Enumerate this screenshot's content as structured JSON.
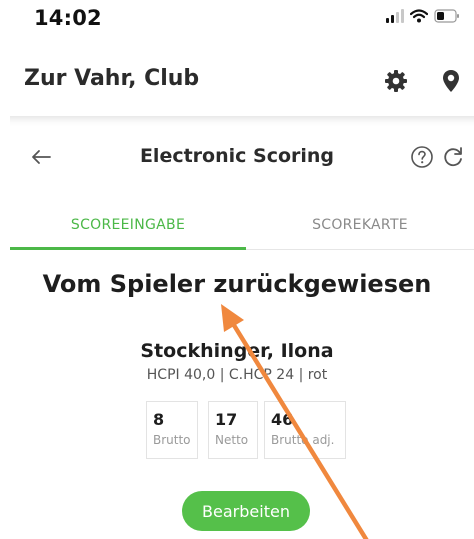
{
  "status_bar": {
    "time": "14:02",
    "icons": [
      "signal-icon",
      "wifi-icon",
      "battery-icon"
    ]
  },
  "header": {
    "club_name": "Zur Vahr, Club",
    "icons": [
      "gear-icon",
      "location-pin-icon"
    ]
  },
  "scoring": {
    "title": "Electronic Scoring",
    "icons": [
      "back-arrow-icon",
      "help-icon",
      "refresh-icon"
    ]
  },
  "tabs": [
    {
      "label": "SCOREEINGABE",
      "active": true
    },
    {
      "label": "SCOREKARTE",
      "active": false
    }
  ],
  "status_message": "Vom Spieler zurückgewiesen",
  "player": {
    "name": "Stockhinger, Ilona",
    "info": "HCPI 40,0 | C.HCP 24 | rot"
  },
  "scores": [
    {
      "value": "8",
      "label": "Brutto"
    },
    {
      "value": "17",
      "label": "Netto"
    },
    {
      "value": "46",
      "label": "Brutto adj."
    }
  ],
  "edit_button": "Bearbeiten",
  "colors": {
    "accent": "#4cb848",
    "button": "#55c04a",
    "annotation": "#f0883e"
  }
}
